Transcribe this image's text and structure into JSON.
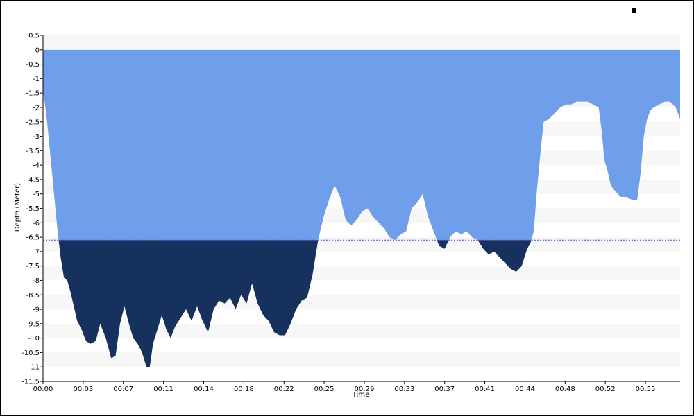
{
  "chart_data": {
    "type": "area",
    "title": "",
    "xlabel": "Time",
    "ylabel": "Depth (Meter)",
    "ylim": [
      -11.5,
      0.5
    ],
    "xlim_minutes": [
      0,
      57.9
    ],
    "y_ticks": [
      "0.5",
      "0",
      "-0.5",
      "-1",
      "-1.5",
      "-2",
      "-2.5",
      "-3",
      "-3.5",
      "-4",
      "-4.5",
      "-5",
      "-5.5",
      "-6",
      "-6.5",
      "-7",
      "-7.5",
      "-8",
      "-8.5",
      "-9",
      "-9.5",
      "-10",
      "-10.5",
      "-11",
      "-11.5"
    ],
    "x_ticks": [
      "00:00",
      "00:03",
      "00:07",
      "00:11",
      "00:14",
      "00:18",
      "00:22",
      "00:25",
      "00:29",
      "00:33",
      "00:37",
      "00:41",
      "00:44",
      "00:48",
      "00:52",
      "00:55"
    ],
    "x_tick_minutes": [
      0,
      3.65,
      7.3,
      10.95,
      14.6,
      18.25,
      21.9,
      25.55,
      29.2,
      32.85,
      36.5,
      40.15,
      43.8,
      47.45,
      51.1,
      54.75
    ],
    "threshold_depth": -6.6,
    "grid": "alternating horizontal bands",
    "legend": "top-right marker, no label",
    "colors": {
      "above_threshold": "#6f9fea",
      "below_threshold": "#17315f",
      "threshold_line": "#4a4ae6",
      "band": "#f7f7f7",
      "axis": "#000000",
      "minor_tick": "#cc3333"
    },
    "series": [
      {
        "x": [
          0,
          0.15,
          0.4,
          0.7,
          1.0,
          1.3,
          1.6,
          1.9,
          2.2,
          2.5,
          2.8,
          3.1,
          3.5,
          3.9,
          4.3,
          4.8,
          5.2,
          5.7,
          6.2,
          6.6,
          7.0,
          7.4,
          7.8,
          8.2,
          8.6,
          9.0,
          9.4,
          9.7,
          10.0,
          10.4,
          10.8,
          11.2,
          11.6,
          12.0,
          12.5,
          13.0,
          13.5,
          14.0,
          14.5,
          15.0,
          15.5,
          16.0,
          16.5,
          17.0,
          17.5,
          18.0,
          18.5,
          19.0,
          19.5,
          20.0,
          20.5,
          21.0,
          21.5,
          22.0,
          22.5,
          23.0,
          23.5,
          24.0,
          24.5,
          25.0,
          25.5,
          26.0,
          26.5,
          27.0,
          27.5,
          28.0,
          28.5,
          29.0,
          29.5,
          30.0,
          30.5,
          31.0,
          31.5,
          32.0,
          32.5,
          33.0,
          33.5,
          34.0,
          34.5,
          35.0,
          35.5,
          36.0,
          36.5,
          37.0,
          37.5,
          38.0,
          38.5,
          39.0,
          39.5,
          40.0,
          40.5,
          41.0,
          41.5,
          42.0,
          42.5,
          43.0,
          43.5,
          44.0,
          44.3,
          44.6,
          44.9,
          45.2,
          45.5,
          46.0,
          46.5,
          47.0,
          47.5,
          48.0,
          48.5,
          49.0,
          49.5,
          50.0,
          50.5,
          50.8,
          51.0,
          51.3,
          51.6,
          52.0,
          52.5,
          53.0,
          53.5,
          54.0,
          54.3,
          54.6,
          54.9,
          55.2,
          55.5,
          56.0,
          56.5,
          57.0,
          57.5,
          57.9
        ],
        "values": [
          -1.5,
          -1.8,
          -2.6,
          -3.8,
          -5.0,
          -6.2,
          -7.2,
          -7.9,
          -8.0,
          -8.4,
          -8.9,
          -9.4,
          -9.7,
          -10.1,
          -10.2,
          -10.1,
          -9.5,
          -10.0,
          -10.7,
          -10.6,
          -9.5,
          -8.9,
          -9.5,
          -10.0,
          -10.2,
          -10.5,
          -11.0,
          -11.0,
          -10.2,
          -9.7,
          -9.2,
          -9.7,
          -10.0,
          -9.6,
          -9.3,
          -9.0,
          -9.4,
          -8.9,
          -9.4,
          -9.8,
          -9.0,
          -8.7,
          -8.8,
          -8.6,
          -9.0,
          -8.5,
          -8.8,
          -8.1,
          -8.8,
          -9.2,
          -9.4,
          -9.8,
          -9.9,
          -9.9,
          -9.5,
          -9.0,
          -8.7,
          -8.6,
          -7.8,
          -6.6,
          -5.8,
          -5.2,
          -4.7,
          -5.1,
          -5.9,
          -6.1,
          -5.9,
          -5.6,
          -5.5,
          -5.8,
          -6.0,
          -6.2,
          -6.5,
          -6.6,
          -6.4,
          -6.3,
          -5.5,
          -5.3,
          -5.0,
          -5.8,
          -6.3,
          -6.8,
          -6.9,
          -6.5,
          -6.3,
          -6.4,
          -6.3,
          -6.5,
          -6.6,
          -6.9,
          -7.1,
          -7.0,
          -7.2,
          -7.4,
          -7.6,
          -7.7,
          -7.5,
          -6.9,
          -6.7,
          -6.3,
          -4.8,
          -3.6,
          -2.5,
          -2.4,
          -2.2,
          -2.0,
          -1.9,
          -1.9,
          -1.8,
          -1.8,
          -1.8,
          -1.9,
          -2.0,
          -2.9,
          -3.8,
          -4.2,
          -4.7,
          -4.9,
          -5.1,
          -5.1,
          -5.2,
          -5.2,
          -4.3,
          -3.0,
          -2.4,
          -2.1,
          -2.0,
          -1.9,
          -1.8,
          -1.8,
          -2.0,
          -2.4
        ]
      }
    ]
  }
}
